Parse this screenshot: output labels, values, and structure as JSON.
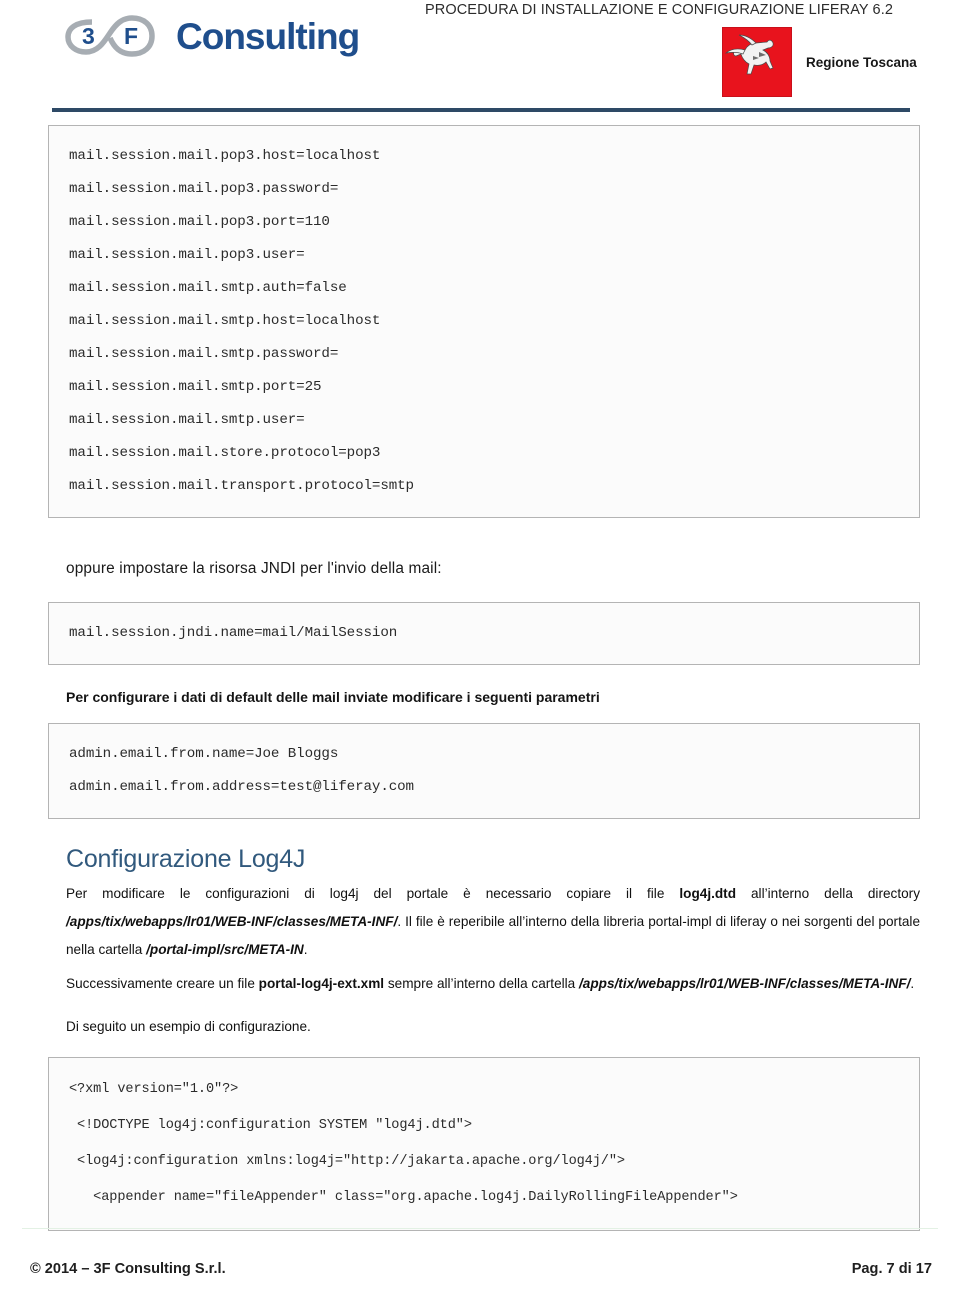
{
  "header": {
    "doc_title": "PROCEDURA DI INSTALLAZIONE E CONFIGURAZIONE LIFERAY 6.2",
    "logo": {
      "mark_digit": "3",
      "mark_letter": "F",
      "word": "Consulting",
      "icon": "infinity-loop-icon"
    },
    "regione": {
      "label": "Regione Toscana",
      "flag_color": "#e8131d",
      "icon": "pegasus-icon"
    },
    "rule_color": "#2e4a66"
  },
  "mail_props": {
    "lines": [
      "mail.session.mail.pop3.host=localhost",
      "mail.session.mail.pop3.password=",
      "mail.session.mail.pop3.port=110",
      "mail.session.mail.pop3.user=",
      "mail.session.mail.smtp.auth=false",
      "mail.session.mail.smtp.host=localhost",
      "mail.session.mail.smtp.password=",
      "mail.session.mail.smtp.port=25",
      "mail.session.mail.smtp.user=",
      "mail.session.mail.store.protocol=pop3",
      "mail.session.mail.transport.protocol=smtp"
    ]
  },
  "jndi": {
    "intro": "oppure impostare la risorsa JNDI per l'invio della mail:",
    "lines": [
      "mail.session.jndi.name=mail/MailSession"
    ]
  },
  "admin_email": {
    "intro": "Per configurare i dati di default delle mail inviate modificare i seguenti parametri",
    "lines": [
      "admin.email.from.name=Joe Bloggs",
      "admin.email.from.address=test@liferay.com"
    ]
  },
  "log4j_section": {
    "title": "Configurazione Log4J",
    "p1_a": "Per  modificare  le  configurazioni  di  log4j  del  portale  è  necessario  copiare  il  file  ",
    "p1_file": "log4j.dtd",
    "p1_b": " all’interno  della  directory ",
    "p1_path": "/apps/tix/webapps/lr01/WEB-INF/classes/META-INF/",
    "p1_c": ". Il file è reperibile all’interno della libreria portal-impl di liferay o nei sorgenti del portale nella cartella ",
    "p1_path2": "/portal-impl/src/META-IN",
    "p1_d": ".",
    "p2_a": "Successivamente   creare   un   file   ",
    "p2_file": "portal-log4j-ext.xml",
    "p2_b": "  sempre   all’interno   della   cartella  ",
    "p2_path": "/apps/tix/webapps/lr01/WEB-INF/classes/META-INF/",
    "p2_c": ".",
    "p3": "Di seguito un esempio di configurazione."
  },
  "xml_example": {
    "lines": [
      "<?xml version=\"1.0\"?>",
      " <!DOCTYPE log4j:configuration SYSTEM \"log4j.dtd\">",
      " <log4j:configuration xmlns:log4j=\"http://jakarta.apache.org/log4j/\">",
      "   <appender name=\"fileAppender\" class=\"org.apache.log4j.DailyRollingFileAppender\">"
    ]
  },
  "footer": {
    "copyright": "© 2014 – 3F Consulting S.r.l.",
    "page": "Pag. 7 di 17"
  }
}
